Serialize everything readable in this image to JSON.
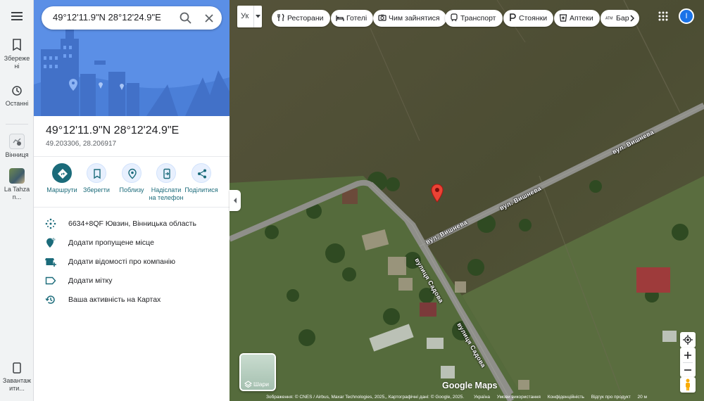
{
  "search": {
    "value": "49°12'11.9\"N 28°12'24.9\"E"
  },
  "rail": {
    "saved": "Збережені",
    "recent": "Останні",
    "recent_places": [
      {
        "label": "Вінниця"
      },
      {
        "label": "La Tahzan..."
      }
    ],
    "download": "Завантажити..."
  },
  "place": {
    "title": "49°12'11.9\"N 28°12'24.9\"E",
    "coords": "49.203306, 28.206917"
  },
  "actions": [
    {
      "label": "Маршрути",
      "icon": "directions-icon"
    },
    {
      "label": "Зберегти",
      "icon": "bookmark-icon"
    },
    {
      "label": "Поблизу",
      "icon": "nearby-icon"
    },
    {
      "label": "Надіслати на телефон",
      "icon": "send-to-phone-icon"
    },
    {
      "label": "Поділитися",
      "icon": "share-icon"
    }
  ],
  "details": [
    {
      "text": "6634+8QF Ювзин, Вінницька область",
      "icon": "plus-code-icon"
    },
    {
      "text": "Додати пропущене місце",
      "icon": "add-place-icon"
    },
    {
      "text": "Додати відомості про компанію",
      "icon": "add-business-icon"
    },
    {
      "text": "Додати мітку",
      "icon": "label-icon"
    },
    {
      "text": "Ваша активність на Картах",
      "icon": "history-icon"
    }
  ],
  "map": {
    "lang_label": "Ук",
    "chips": [
      {
        "label": "Ресторани",
        "icon": "restaurant-icon"
      },
      {
        "label": "Готелі",
        "icon": "hotel-icon"
      },
      {
        "label": "Чим зайнятися",
        "icon": "camera-icon"
      },
      {
        "label": "Транспорт",
        "icon": "transit-icon"
      },
      {
        "label": "Стоянки",
        "icon": "parking-icon"
      },
      {
        "label": "Аптеки",
        "icon": "pharmacy-icon"
      },
      {
        "label": "Бар",
        "icon": "atm-icon"
      }
    ],
    "streets": [
      "вул. Вишнева",
      "вул. Вишнева",
      "вул. Вишнева",
      "вулиця Садова",
      "вулиця Садова"
    ],
    "layers_label": "Шари",
    "google_label": "Google Maps",
    "footer": [
      "Зображення: © CNES / Airbus, Maxar Technologies, 2025,, Картографічні дані: © Google, 2025.",
      "Україна",
      "Умови використання",
      "Конфіденційність",
      "Відгук про продукт",
      "20 м"
    ],
    "account_initial": "I",
    "colors": {
      "pin": "#ea4335",
      "accent": "#1b6b7a",
      "road": "#8f8f8a"
    }
  }
}
